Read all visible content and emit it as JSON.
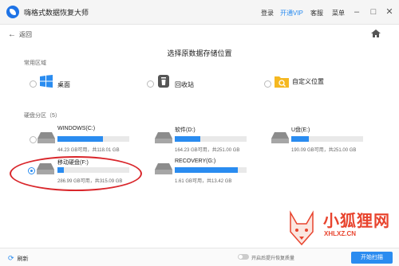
{
  "app": {
    "title": "嗨格式数据恢复大师",
    "menu": {
      "login": "登录",
      "vip": "开通VIP",
      "service": "客服",
      "menu": "菜单"
    }
  },
  "nav": {
    "back": "返回"
  },
  "heading": "选择原数据存储位置",
  "common": {
    "title": "常用区域",
    "items": [
      {
        "label": "桌面",
        "icon": "windows-icon"
      },
      {
        "label": "回收站",
        "icon": "recycle-bin-icon"
      },
      {
        "label": "自定义位置",
        "icon": "folder-search-icon"
      }
    ]
  },
  "disks": {
    "title": "硬盘分区（5）",
    "items": [
      {
        "name": "WINDOWS(C:)",
        "info": "44.23 GB可用，共118.01 GB",
        "used_fraction": 0.63,
        "selected": false
      },
      {
        "name": "软件(D:)",
        "info": "164.23 GB可用，共251.00 GB",
        "used_fraction": 0.35,
        "selected": false
      },
      {
        "name": "U盘(E:)",
        "info": "190.09 GB可用，共251.00 GB",
        "used_fraction": 0.24,
        "selected": false
      },
      {
        "name": "移动硬盘(F:)",
        "info": "286.99 GB可用，共315.09 GB",
        "used_fraction": 0.09,
        "selected": true
      },
      {
        "name": "RECOVERY(G:)",
        "info": "1.61 GB可用，共13.42 GB",
        "used_fraction": 0.88,
        "selected": false
      }
    ]
  },
  "footer": {
    "refresh": "刷新",
    "toggle_label": "开启后提升恢复质量",
    "start": "开始扫描"
  },
  "watermark": {
    "text": "小狐狸网",
    "sub": "XHLXZ.CN"
  },
  "colors": {
    "accent": "#2a8cf0",
    "circle": "#d9262b"
  }
}
